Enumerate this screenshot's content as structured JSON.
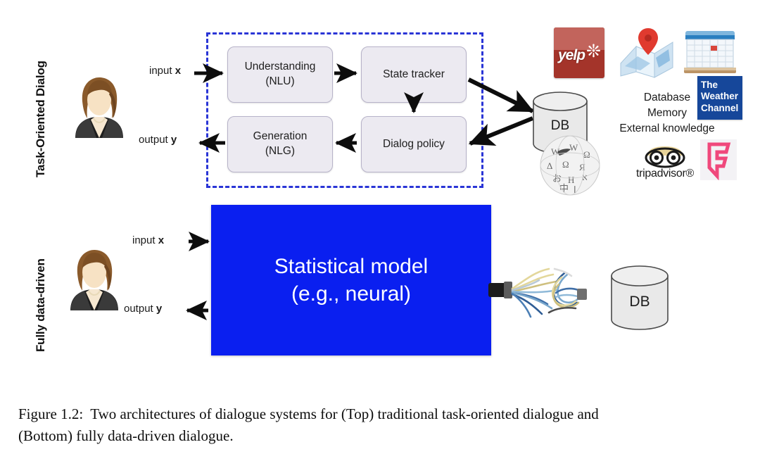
{
  "figure": {
    "caption_line1": "Figure 1.2:  Two architectures of dialogue systems for (Top) traditional task-oriented dialogue and",
    "caption_line2": "(Bottom) fully data-driven dialogue."
  },
  "rows": {
    "top_label": "Task-Oriented Dialog",
    "bottom_label": "Fully data-driven"
  },
  "top": {
    "input_label": "input x",
    "input_var": "x",
    "input_word": "input ",
    "output_word": "output ",
    "output_var": "y",
    "boxes": [
      {
        "id": "nlu",
        "line1": "Understanding",
        "line2": "(NLU)"
      },
      {
        "id": "state",
        "line1": "State tracker",
        "line2": ""
      },
      {
        "id": "nlg",
        "line1": "Generation",
        "line2": "(NLG)"
      },
      {
        "id": "policy",
        "line1": "Dialog policy",
        "line2": ""
      }
    ],
    "db_label": "DB",
    "knowledge": {
      "line1": "Database",
      "line2": "Memory",
      "line3": "External knowledge"
    },
    "logos": [
      {
        "name": "yelp-logo",
        "text": "yelp"
      },
      {
        "name": "google-maps-logo",
        "text": ""
      },
      {
        "name": "calendar-logo",
        "text": ""
      },
      {
        "name": "weather-channel-logo",
        "line1": "The",
        "line2": "Weather",
        "line3": "Channel"
      },
      {
        "name": "wikipedia-logo",
        "text": ""
      },
      {
        "name": "tripadvisor-logo",
        "text": "tripadvisor"
      },
      {
        "name": "foursquare-logo",
        "text": ""
      }
    ]
  },
  "bottom": {
    "input_word": "input ",
    "input_var": "x",
    "output_word": "output ",
    "output_var": "y",
    "model_line1": "Statistical model",
    "model_line2": "(e.g., neural)",
    "db_label": "DB"
  },
  "colors": {
    "model_blue": "#0a1ff0",
    "dashed_border": "#2a35d6",
    "box_fill": "#eceaf1",
    "box_border": "#b7b3c9",
    "weather_blue": "#16479a",
    "yelp_red": "#a4342a",
    "foursquare_pink": "#f0487c",
    "cylinder_fill": "#e8e8e8"
  }
}
